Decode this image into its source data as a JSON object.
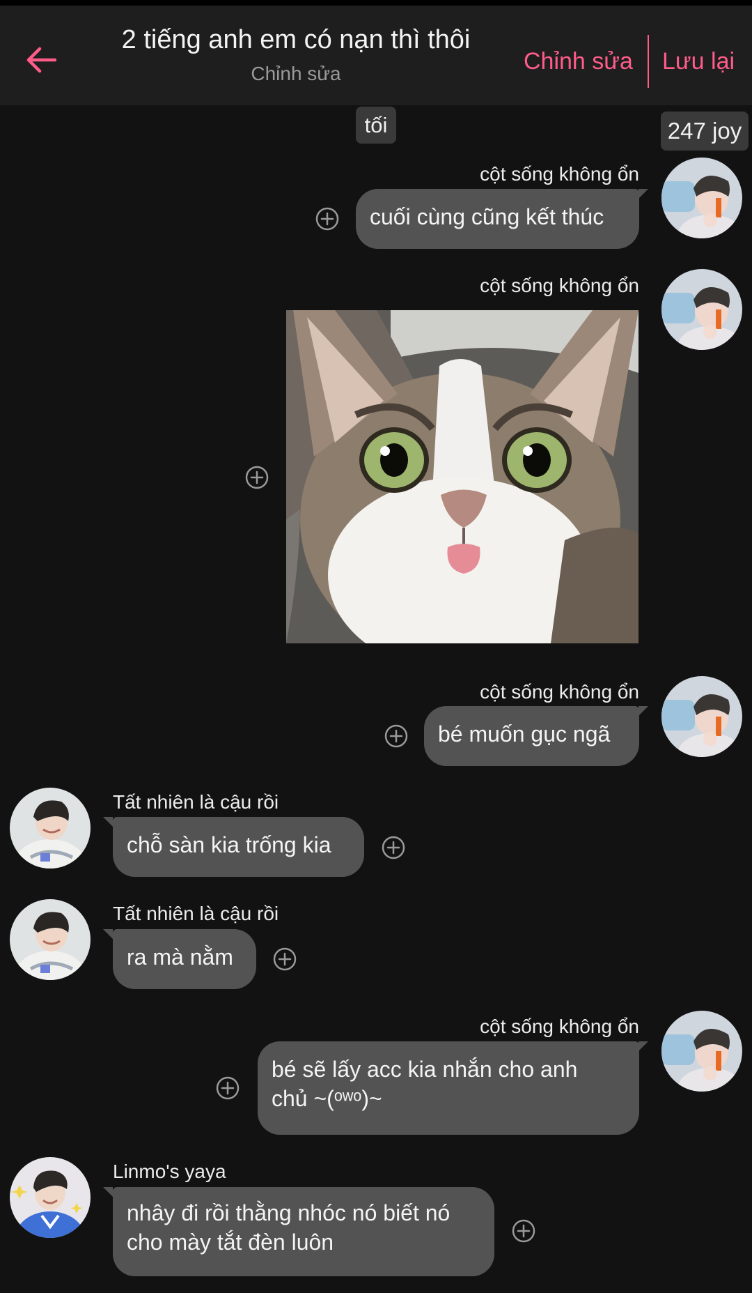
{
  "header": {
    "title": "2 tiếng anh em có nạn thì thôi",
    "subtitle": "Chỉnh sửa",
    "edit_label": "Chỉnh sửa",
    "save_label": "Lưu lại",
    "accent_color": "#ff5c8a"
  },
  "badges": {
    "time_of_day": "tối",
    "joy_count": "247 joy"
  },
  "messages": [
    {
      "sender": "cột sống không ổn",
      "text": "cuối cùng cũng kết thúc",
      "side": "right"
    },
    {
      "sender": "cột sống không ổn",
      "image": "wide-eyed-cat-photo",
      "side": "right"
    },
    {
      "sender": "cột sống không ổn",
      "text": "bé muốn gục ngã",
      "side": "right"
    },
    {
      "sender": "Tất nhiên là cậu rồi",
      "text": "chỗ sàn kia trống kia",
      "side": "left"
    },
    {
      "sender": "Tất nhiên là cậu rồi",
      "text": "ra mà nằm",
      "side": "left"
    },
    {
      "sender": "cột sống không ổn",
      "lines": [
        "bé sẽ lấy acc kia nhắn cho anh",
        "chủ ~(ᵒʷᵒ)~"
      ],
      "side": "right"
    },
    {
      "sender": "Linmo's yaya",
      "lines": [
        "nhây đi rồi thằng nhóc nó biết nó",
        "cho mày tắt đèn luôn"
      ],
      "side": "left"
    }
  ],
  "icons": {
    "back": "arrow-left-icon",
    "add": "plus-circle-icon"
  }
}
